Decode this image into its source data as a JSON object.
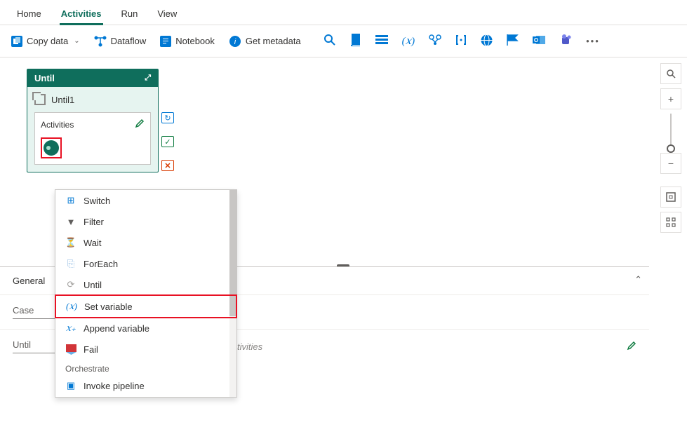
{
  "tabs": {
    "home": "Home",
    "activities": "Activities",
    "run": "Run",
    "view": "View"
  },
  "toolbar": {
    "copy_data": "Copy data",
    "dataflow": "Dataflow",
    "notebook": "Notebook",
    "get_metadata": "Get metadata"
  },
  "until_card": {
    "title": "Until",
    "name": "Until1",
    "activities_label": "Activities"
  },
  "dropdown": {
    "switch": "Switch",
    "filter": "Filter",
    "wait": "Wait",
    "foreach": "ForEach",
    "until": "Until",
    "set_variable": "Set variable",
    "append_variable": "Append variable",
    "fail": "Fail",
    "orchestrate_cat": "Orchestrate",
    "invoke_pipeline": "Invoke pipeline"
  },
  "props": {
    "general_tab": "General",
    "case_label": "Case",
    "until_label": "Until",
    "activities_col": "tivities"
  }
}
